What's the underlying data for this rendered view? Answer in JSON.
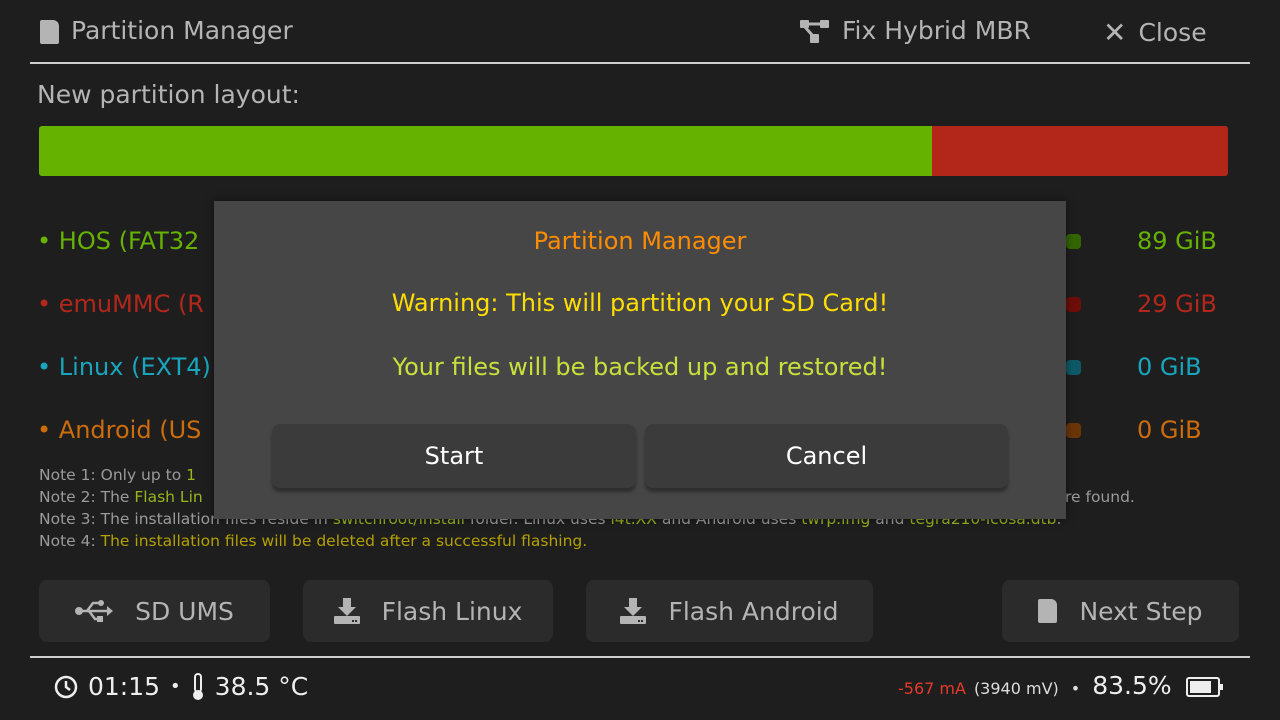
{
  "header": {
    "title": "Partition Manager",
    "fix_hybrid_mbr": "Fix Hybrid MBR",
    "close": "Close"
  },
  "layout_label": "New partition layout:",
  "layout_bar": {
    "segments": [
      {
        "name": "HOS",
        "fraction": 0.751,
        "color": "#66b200"
      },
      {
        "name": "emuMMC",
        "fraction": 0.249,
        "color": "#b3271b"
      }
    ]
  },
  "partitions": [
    {
      "label": "• HOS (FAT32",
      "size": "89 GiB",
      "color": "#66b200",
      "knob": "#336600"
    },
    {
      "label": "• emuMMC (R",
      "size": "29 GiB",
      "color": "#b3271b",
      "knob": "#6e0e0a"
    },
    {
      "label": "• Linux (EXT4)",
      "size": "0 GiB",
      "color": "#18a6be",
      "knob": "#0d5a66"
    },
    {
      "label": "• Android (US",
      "size": "0 GiB",
      "color": "#cc6c0a",
      "knob": "#6a3606"
    }
  ],
  "notes": {
    "n1_a": "Note 1: Only up to ",
    "n1_b": "1",
    "n2_a": "Note 2: The ",
    "n2_b": "Flash Lin",
    "n2_c": "re found.",
    "n3_a": "Note 3: The installation files reside in ",
    "n3_b": "switchroot/install",
    "n3_c": " folder. Linux uses ",
    "n3_d": "l4t.XX",
    "n3_e": " and Android uses ",
    "n3_f": "twrp.img",
    "n3_g": " and ",
    "n3_h": "tegra210-icosa.dtb",
    "n3_i": ".",
    "n4_a": "Note 4: ",
    "n4_b": "The installation files will be deleted after a successful flashing."
  },
  "buttons": {
    "sd_ums": "SD UMS",
    "flash_linux": "Flash Linux",
    "flash_android": "Flash Android",
    "next_step": "Next Step"
  },
  "dialog": {
    "title": "Partition Manager",
    "warning": "Warning: This will partition your SD Card!",
    "info": "Your files will be backed up and restored!",
    "start": "Start",
    "cancel": "Cancel"
  },
  "status": {
    "time": "01:15",
    "temp": "38.5 °C",
    "current": "-567 mA",
    "voltage": "(3940 mV)",
    "battery": "83.5%",
    "battery_level": 0.835
  }
}
